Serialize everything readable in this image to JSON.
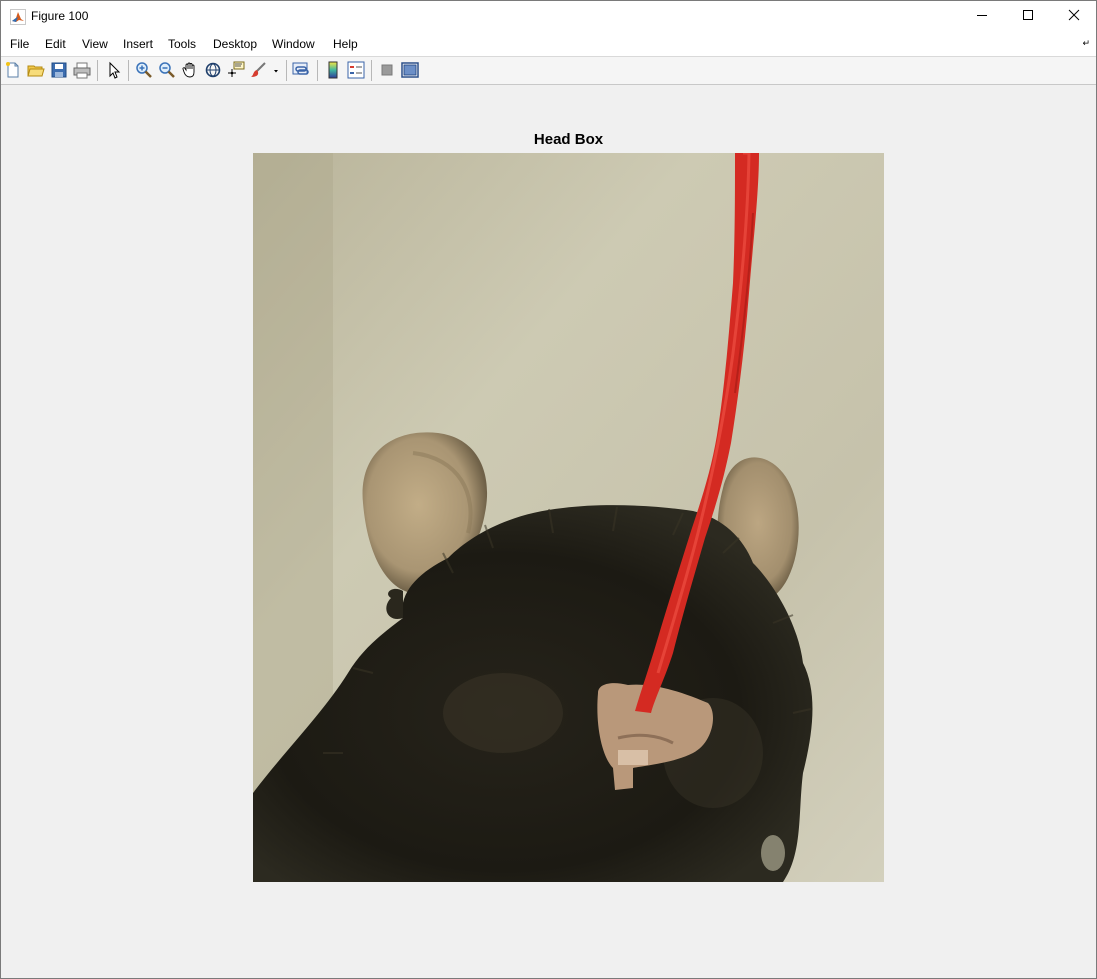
{
  "window": {
    "title": "Figure 100",
    "app_icon": "matlab-icon",
    "controls": [
      "minimize-icon",
      "maximize-icon",
      "close-icon"
    ]
  },
  "menubar": {
    "items": [
      "File",
      "Edit",
      "View",
      "Insert",
      "Tools",
      "Desktop",
      "Window",
      "Help"
    ]
  },
  "toolbar": {
    "buttons": [
      "new-figure-icon",
      "open-file-icon",
      "save-icon",
      "print-icon",
      "edit-plot-icon",
      "zoom-in-icon",
      "zoom-out-icon",
      "pan-icon",
      "rotate-3d-icon",
      "data-cursor-icon",
      "brush-icon",
      "link-plot-icon",
      "insert-colorbar-icon",
      "insert-legend-icon",
      "hide-plot-tools-icon",
      "show-plot-tools-icon"
    ]
  },
  "figure": {
    "axes_title": "Head Box",
    "image_subject": "image",
    "colors": {
      "background": "#c9c4a8",
      "fur": "#1e1c15",
      "ear": "#b09c78",
      "string": "#d42a22"
    }
  }
}
